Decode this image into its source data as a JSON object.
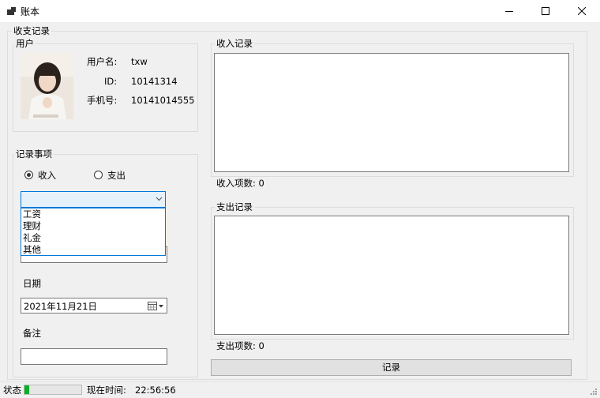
{
  "window": {
    "title": "账本"
  },
  "main_group": {
    "label": "收支记录"
  },
  "user": {
    "group_label": "用户",
    "username_label": "用户名:",
    "username": "txw",
    "id_label": "ID:",
    "id": "10141314",
    "phone_label": "手机号:",
    "phone": "10141014555"
  },
  "record_item": {
    "group_label": "记录事项",
    "radio_income": "收入",
    "radio_expense": "支出",
    "selected": "income",
    "category_value": "",
    "category_options": [
      "工资",
      "理财",
      "礼金",
      "其他"
    ],
    "date_label": "日期",
    "date_value": "2021年11月21日",
    "note_label": "备注",
    "note_value": ""
  },
  "income_records": {
    "group_label": "收入记录",
    "count_label": "收入项数: 0"
  },
  "expense_records": {
    "group_label": "支出记录",
    "count_label": "支出项数: 0"
  },
  "record_button_label": "记录",
  "status_bar": {
    "status_label": "状态",
    "progress_percent": 8,
    "time_label": "现在时间:",
    "time_value": "22:56:56"
  },
  "colors": {
    "progress": "#06b025",
    "selection": "#cce8ff",
    "focus_border": "#0078d7"
  }
}
